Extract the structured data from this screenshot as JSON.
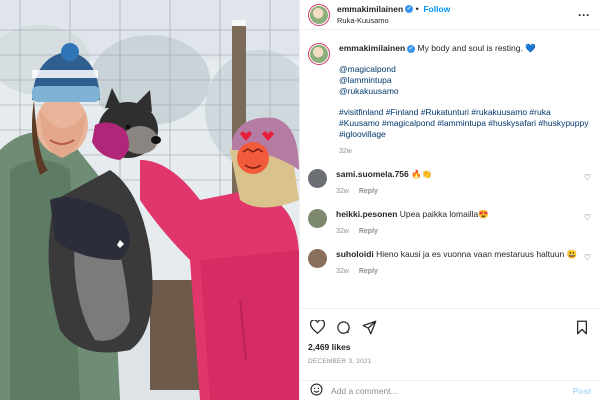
{
  "header": {
    "username": "emmakimilainen",
    "follow_label": "Follow",
    "separator": "•",
    "location": "Ruka-Kuusamo",
    "more_icon": "more-dots-icon"
  },
  "caption": {
    "username": "emmakimilainen",
    "text": "My body and soul is resting. 💙",
    "mentions": [
      "@magicalpond",
      "@lammintupa",
      "@rukakuusamo"
    ],
    "hashtags": "#visitfinland #Finland #Rukatunturi #rukakuusamo #ruka #Kuusamo #magicalpond #lammintupa #huskysafari #huskypuppy #igloovillage",
    "time": "32w"
  },
  "comments": [
    {
      "username": "sami.suomela.756",
      "text": "🔥👏",
      "time": "32w",
      "reply": "Reply"
    },
    {
      "username": "heikki.pesonen",
      "text": "Upea paikka lomailla😍",
      "time": "32w",
      "reply": "Reply"
    },
    {
      "username": "suholoidi",
      "text": "Hieno kausi ja es vuonna vaan mestaruus haltuun 😃",
      "time": "32w",
      "reply": "Reply"
    }
  ],
  "actions": {
    "likes": "2,469 likes",
    "date": "DECEMBER 3, 2021",
    "icons": [
      "heart-icon",
      "comment-icon",
      "share-icon",
      "bookmark-icon"
    ]
  },
  "add_comment": {
    "placeholder": "Add a comment...",
    "post_label": "Post",
    "emoji_icon": "emoji-icon"
  },
  "colors": {
    "accent": "#0095f6",
    "link": "#00376b",
    "muted": "#8e8e8e"
  }
}
